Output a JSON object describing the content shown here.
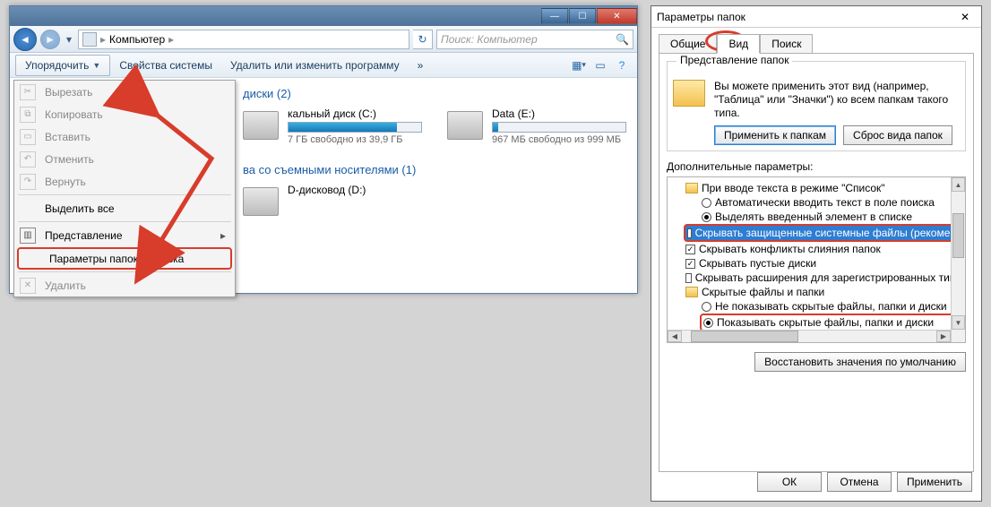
{
  "explorer": {
    "breadcrumb": "Компьютер",
    "search_placeholder": "Поиск: Компьютер",
    "toolbar": {
      "organize": "Упорядочить",
      "props": "Свойства системы",
      "uninstall": "Удалить или изменить программу",
      "more": "»"
    },
    "menu": {
      "cut": "Вырезать",
      "copy": "Копировать",
      "paste": "Вставить",
      "undo": "Отменить",
      "redo": "Вернуть",
      "select_all": "Выделить все",
      "layout": "Представление",
      "folder_opts": "Параметры папок и поиска",
      "delete": "Удалить"
    },
    "content": {
      "disks_header": "диски (2)",
      "drive_c": {
        "name": "кальный диск (C:)",
        "free": "7 ГБ свободно из 39,9 ГБ",
        "pct": 82
      },
      "drive_e": {
        "name": "Data (E:)",
        "free": "967 МБ свободно из 999 МБ",
        "pct": 4
      },
      "removable_header": "ва со съемными носителями (1)",
      "dvd": "D-дисковод (D:)"
    }
  },
  "dialog": {
    "title": "Параметры папок",
    "tabs": {
      "general": "Общие",
      "view": "Вид",
      "search": "Поиск"
    },
    "fv": {
      "group": "Представление папок",
      "text": "Вы можете применить этот вид (например, \"Таблица\" или \"Значки\") ко всем папкам такого типа.",
      "apply": "Применить к папкам",
      "reset": "Сброс вида папок"
    },
    "adv_label": "Дополнительные параметры:",
    "tree": {
      "n0": "При вводе текста в режиме \"Список\"",
      "n1": "Автоматически вводить текст в поле поиска",
      "n2": "Выделять введенный элемент в списке",
      "n3": "Скрывать защищенные системные файлы (рекомен",
      "n4": "Скрывать конфликты слияния папок",
      "n5": "Скрывать пустые диски",
      "n6": "Скрывать расширения для зарегистрированных типо",
      "n7": "Скрытые файлы и папки",
      "n8": "Не показывать скрытые файлы, папки и диски",
      "n9": "Показывать скрытые файлы, папки и диски"
    },
    "restore": "Восстановить значения по умолчанию",
    "ok": "ОК",
    "cancel": "Отмена",
    "apply": "Применить"
  }
}
